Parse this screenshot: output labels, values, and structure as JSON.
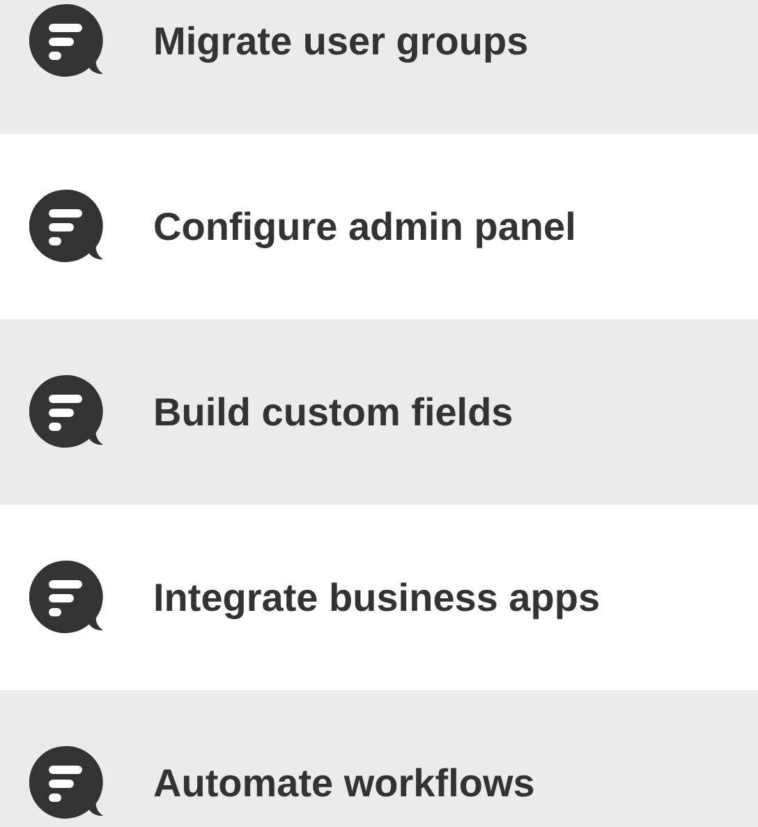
{
  "items": [
    {
      "label": "Migrate user groups"
    },
    {
      "label": "Configure admin panel"
    },
    {
      "label": "Build custom fields"
    },
    {
      "label": "Integrate business apps"
    },
    {
      "label": "Automate workflows"
    }
  ]
}
